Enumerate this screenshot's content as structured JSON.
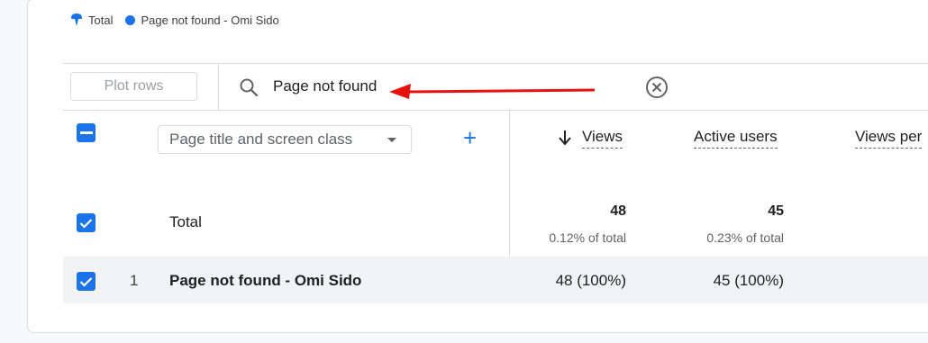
{
  "legend": {
    "total_label": "Total",
    "series_label": "Page not found - Omi Sido",
    "series_color": "#1a73e8",
    "total_color": "#1a73e8"
  },
  "toolbar": {
    "plot_rows_label": "Plot rows",
    "search_value": "Page not found"
  },
  "table": {
    "dimension_select": "Page title and screen class",
    "add_label": "+",
    "columns": [
      "Views",
      "Active users",
      "Views per"
    ],
    "total": {
      "label": "Total",
      "views": "48",
      "views_pct": "0.12% of total",
      "users": "45",
      "users_pct": "0.23% of total"
    },
    "rows": [
      {
        "index": "1",
        "title": "Page not found - Omi Sido",
        "views": "48 (100%)",
        "users": "45 (100%)"
      }
    ]
  },
  "annotation": {
    "arrow_color": "#e8120c"
  }
}
